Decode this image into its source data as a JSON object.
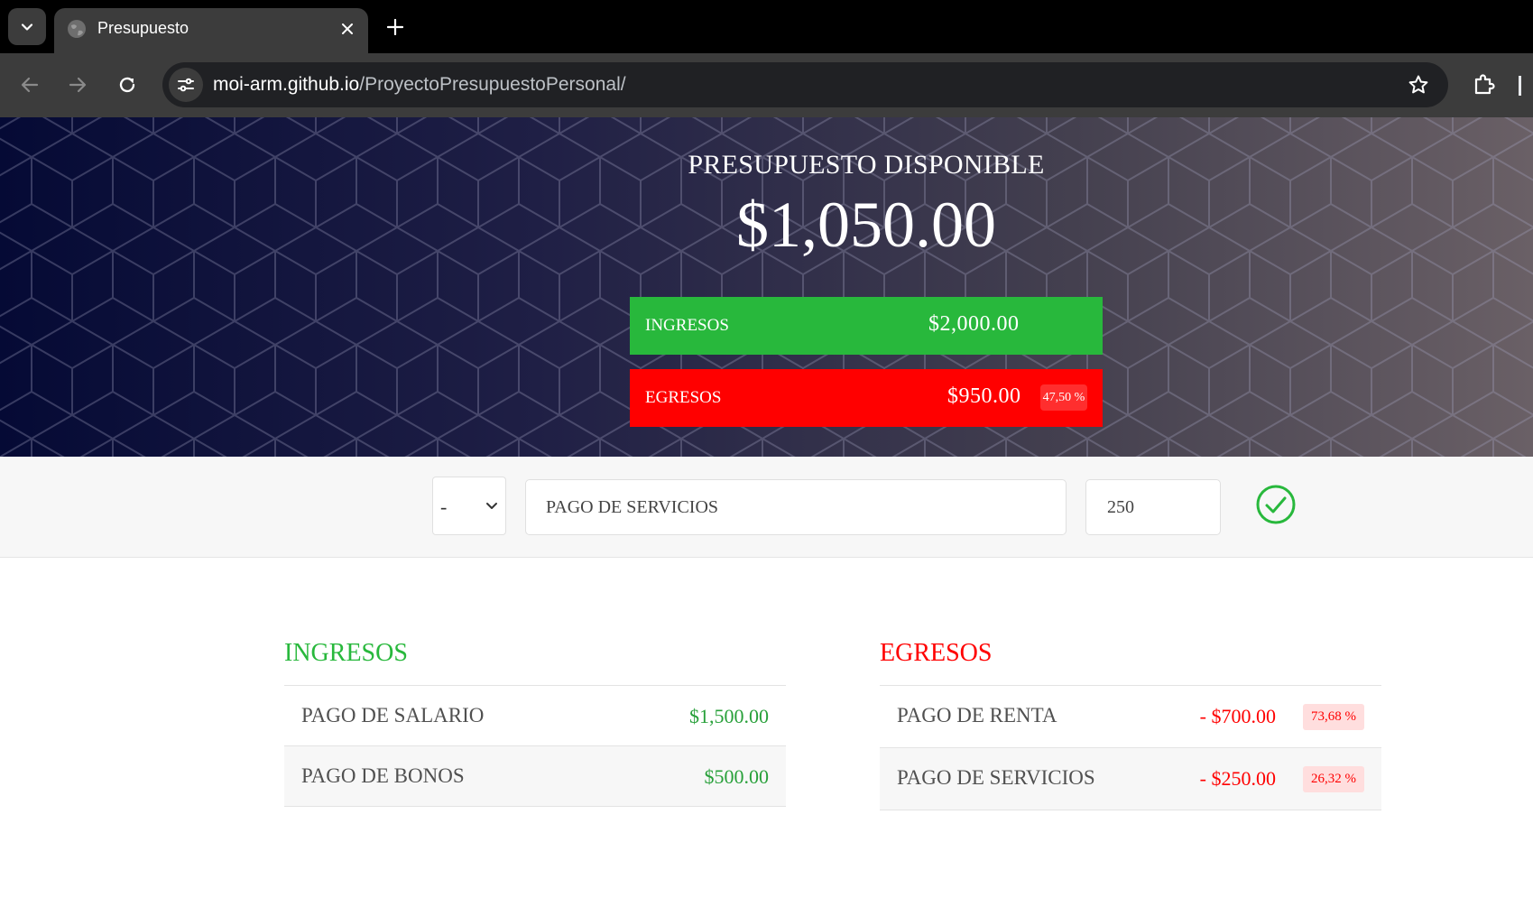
{
  "browser": {
    "tab_title": "Presupuesto",
    "url_host": "moi-arm.github.io",
    "url_path": "/ProyectoPresupuestoPersonal/"
  },
  "header": {
    "title": "PRESUPUESTO DISPONIBLE",
    "available": "$1,050.00",
    "income_label": "INGRESOS",
    "income_value": "$2,000.00",
    "expense_label": "EGRESOS",
    "expense_value": "$950.00",
    "expense_pct": "47,50 %"
  },
  "form": {
    "type_selected": "-",
    "description_value": "PAGO DE SERVICIOS",
    "amount_value": "250"
  },
  "incomes": {
    "title": "INGRESOS",
    "items": [
      {
        "description": "PAGO DE SALARIO",
        "amount": "$1,500.00"
      },
      {
        "description": "PAGO DE BONOS",
        "amount": "$500.00"
      }
    ]
  },
  "expenses": {
    "title": "EGRESOS",
    "items": [
      {
        "description": "PAGO DE RENTA",
        "amount": "- $700.00",
        "pct": "73,68 %"
      },
      {
        "description": "PAGO DE SERVICIOS",
        "amount": "- $250.00",
        "pct": "26,32 %"
      }
    ]
  },
  "colors": {
    "income": "#28b83c",
    "expense": "#ff0000",
    "chrome_dark": "#3c3c3c"
  }
}
